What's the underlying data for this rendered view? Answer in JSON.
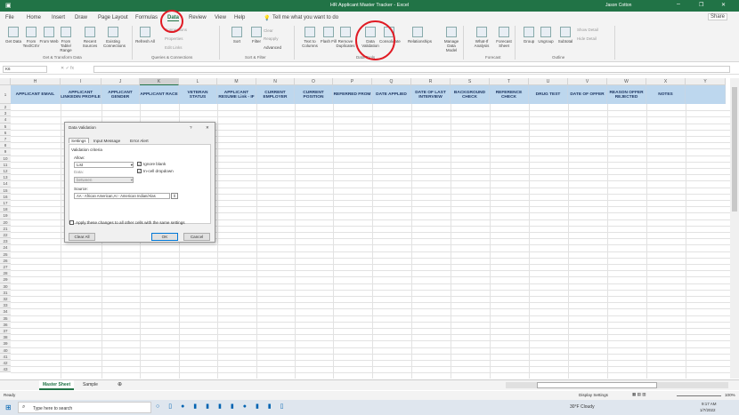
{
  "window": {
    "title": "HR Applicant Master Tracker - Excel",
    "user": "Jason Cotton"
  },
  "tabs": [
    "File",
    "Home",
    "Insert",
    "Draw",
    "Page Layout",
    "Formulas",
    "Data",
    "Review",
    "View",
    "Help"
  ],
  "tell_me": "Tell me what you want to do",
  "share": "Share",
  "ribbon": {
    "buttons": [
      "Get Data",
      "From Text/CSV",
      "From Web",
      "From Table/ Range",
      "Recent Sources",
      "Existing Connections",
      "Refresh All",
      "Sort",
      "Filter",
      "Text to Columns",
      "Flash Fill",
      "Remove Duplicates",
      "Data Validation",
      "Consolidate",
      "Relationships",
      "Manage Data Model",
      "What-If Analysis",
      "Forecast Sheet",
      "Group",
      "Ungroup",
      "Subtotal"
    ],
    "small": [
      "Connections",
      "Properties",
      "Edit Links",
      "Clear",
      "Reapply",
      "Advanced",
      "Show Detail",
      "Hide Detail"
    ],
    "groups": [
      "Get & Transform Data",
      "Queries & Connections",
      "Sort & Filter",
      "Data Tools",
      "Forecast",
      "Outline"
    ]
  },
  "namebox": "K6",
  "columns": [
    "H",
    "I",
    "J",
    "K",
    "L",
    "M",
    "N",
    "O",
    "P",
    "Q",
    "R",
    "S",
    "T",
    "U",
    "V",
    "W",
    "X",
    "Y"
  ],
  "headers": [
    "APPLICANT EMAIL",
    "APPLICANT LINKEDIN PROFILE",
    "APPLICANT GENDER",
    "APPLICANT RACE",
    "VETERAN STATUS",
    "APPLICANT RESUME Link - IF",
    "CURRENT EMPLOYER",
    "CURRENT POSITION",
    "REFERRED FROM",
    "DATE APPLIED",
    "DATE OF LAST INTERVIEW",
    "BACKGROUND CHECK",
    "REFERENCE CHECK",
    "DRUG TEST",
    "DATE OF OFFER",
    "REASON OFFER REJECTED",
    "NOTES",
    ""
  ],
  "rows": [
    1,
    2,
    3,
    4,
    5,
    6,
    7,
    8,
    9,
    10,
    11,
    12,
    13,
    14,
    15,
    16,
    17,
    18,
    19,
    20,
    21,
    22,
    23,
    24,
    25,
    26,
    27,
    28,
    29,
    30,
    31,
    32,
    33,
    34,
    35,
    36,
    37,
    38,
    39,
    40,
    41,
    42,
    43
  ],
  "dialog": {
    "title": "Data Validation",
    "help": "?",
    "close": "✕",
    "tabs": [
      "Settings",
      "Input Message",
      "Error Alert"
    ],
    "criteria": "Validation criteria",
    "allow_label": "Allow:",
    "allow": "List",
    "data_label": "Data:",
    "data": "between",
    "ignore_blank": "Ignore blank",
    "in_cell": "In-cell dropdown",
    "source_label": "Source:",
    "source": "AA - African American,AI - American Indian/Alas",
    "apply_all": "Apply these changes to all other cells with the same settings",
    "clear": "Clear All",
    "ok": "OK",
    "cancel": "Cancel"
  },
  "sheets": [
    "Master Sheet",
    "Sample"
  ],
  "status": {
    "ready": "Ready",
    "display": "Display Settings",
    "zoom": "100%"
  },
  "taskbar": {
    "search": "Type here to search",
    "weather": "30°F Cloudy",
    "time": "9:17 AM",
    "date": "1/7/2022"
  },
  "colors": {
    "excel_green": "#217346",
    "header_fill": "#bdd7ee",
    "annotation": "#e01b24"
  }
}
